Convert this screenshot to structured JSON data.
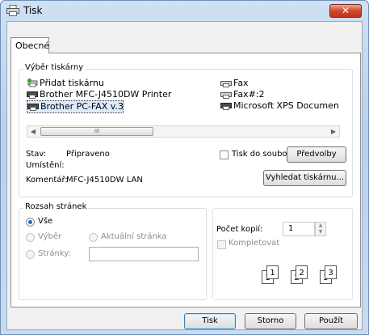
{
  "window": {
    "title": "Tisk",
    "close_glyph": "✕"
  },
  "tabs": [
    {
      "label": "Obecné"
    }
  ],
  "select_printer": {
    "group_title": "Výběr tiskárny",
    "printers": [
      {
        "label": "Přidat tiskárnu",
        "icon": "add-printer-icon"
      },
      {
        "label": "Fax",
        "icon": "fax-icon"
      },
      {
        "label": "Brother MFC-J4510DW Printer",
        "icon": "printer-icon"
      },
      {
        "label": "Fax#:2",
        "icon": "fax-icon"
      },
      {
        "label": "Brother PC-FAX v.3",
        "icon": "printer-icon",
        "selected": true
      },
      {
        "label": "Microsoft XPS Document Writer",
        "icon": "printer-icon"
      }
    ],
    "scroll_thumb_glyph": "III",
    "status_label": "Stav:",
    "status_value": "Připraveno",
    "location_label": "Umístění:",
    "comment_label": "Komentář:",
    "comment_value": "MFC-J4510DW LAN",
    "print_to_file_label": "Tisk do souboru",
    "preferences_button": "Předvolby",
    "find_printer_button": "Vyhledat tiskárnu..."
  },
  "page_range": {
    "group_title": "Rozsah stránek",
    "all_label": "Vše",
    "selection_label": "Výběr",
    "current_page_label": "Aktuální stránka",
    "pages_label": "Stránky:",
    "pages_value": ""
  },
  "copies": {
    "count_label": "Počet kopií:",
    "count_value": "1",
    "collate_label": "Kompletovat",
    "collate_icon_pages": [
      "1",
      "1",
      "2",
      "2",
      "3",
      "3"
    ]
  },
  "footer": {
    "print_button": "Tisk",
    "cancel_button": "Storno",
    "apply_button": "Použít"
  }
}
